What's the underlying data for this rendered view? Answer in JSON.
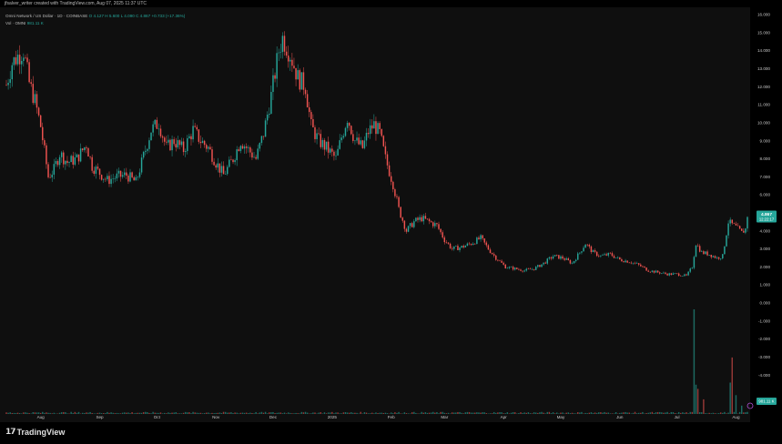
{
  "header": {
    "caption": "jfsalver_writer created with TradingView.com, Aug 07, 2025 11:37 UTC"
  },
  "legend": {
    "symbol": "Omni Network / US Dollar · 1D · COINBASE",
    "ohlc": "O 4.127 H 5.600 L 4.090 C 4.867 +0.733 (+17.36%)",
    "volume_label": "Vol · OMNI",
    "volume_value": "981.11 K"
  },
  "price_badge": {
    "price": "4.867",
    "countdown": "12:22:17"
  },
  "volume_badge": "981.11 K",
  "brand": {
    "name": "TradingView"
  },
  "colors": {
    "up": "#26a69a",
    "down": "#ef5350",
    "background": "#0f0f0f"
  },
  "chart_data": {
    "type": "candlestick",
    "title": "Omni Network / US Dollar",
    "ylim": [
      -5,
      16
    ],
    "y_ticks": [
      "16.000",
      "15.000",
      "14.000",
      "13.000",
      "12.000",
      "11.000",
      "10.000",
      "9.000",
      "8.000",
      "7.000",
      "6.000",
      "5.000",
      "4.000",
      "3.000",
      "2.000",
      "1.000",
      "0.000",
      "-1.000",
      "-2.000",
      "-3.000",
      "-4.000"
    ],
    "x_ticks": [
      {
        "label": "Aug",
        "date": "2024-08-01"
      },
      {
        "label": "Sep",
        "date": "2024-09-01"
      },
      {
        "label": "Oct",
        "date": "2024-10-01"
      },
      {
        "label": "Nov",
        "date": "2024-11-01"
      },
      {
        "label": "Dec",
        "date": "2024-12-01"
      },
      {
        "label": "2025",
        "date": "2025-01-01"
      },
      {
        "label": "Feb",
        "date": "2025-02-01"
      },
      {
        "label": "Mar",
        "date": "2025-03-01"
      },
      {
        "label": "Apr",
        "date": "2025-04-01"
      },
      {
        "label": "May",
        "date": "2025-05-01"
      },
      {
        "label": "Jun",
        "date": "2025-06-01"
      },
      {
        "label": "Jul",
        "date": "2025-07-01"
      },
      {
        "label": "Aug",
        "date": "2025-08-01"
      }
    ],
    "x_range": [
      "2024-07-14",
      "2025-08-07"
    ],
    "close_keypoints": [
      [
        "2024-07-14",
        12.1
      ],
      [
        "2024-07-17",
        13.3
      ],
      [
        "2024-07-20",
        13.7
      ],
      [
        "2024-07-23",
        14.0
      ],
      [
        "2024-07-26",
        12.2
      ],
      [
        "2024-07-29",
        11.2
      ],
      [
        "2024-08-01",
        9.8
      ],
      [
        "2024-08-05",
        7.0
      ],
      [
        "2024-08-08",
        7.4
      ],
      [
        "2024-08-11",
        8.3
      ],
      [
        "2024-08-15",
        7.8
      ],
      [
        "2024-08-20",
        8.0
      ],
      [
        "2024-08-25",
        8.8
      ],
      [
        "2024-08-28",
        7.6
      ],
      [
        "2024-09-01",
        7.2
      ],
      [
        "2024-09-05",
        6.8
      ],
      [
        "2024-09-10",
        7.0
      ],
      [
        "2024-09-15",
        7.1
      ],
      [
        "2024-09-20",
        6.7
      ],
      [
        "2024-09-25",
        8.5
      ],
      [
        "2024-09-28",
        9.6
      ],
      [
        "2024-10-02",
        10.0
      ],
      [
        "2024-10-06",
        8.6
      ],
      [
        "2024-10-10",
        9.0
      ],
      [
        "2024-10-15",
        8.5
      ],
      [
        "2024-10-20",
        9.6
      ],
      [
        "2024-10-24",
        9.0
      ],
      [
        "2024-10-28",
        8.6
      ],
      [
        "2024-11-01",
        7.8
      ],
      [
        "2024-11-05",
        7.1
      ],
      [
        "2024-11-10",
        8.0
      ],
      [
        "2024-11-14",
        9.0
      ],
      [
        "2024-11-18",
        8.5
      ],
      [
        "2024-11-22",
        8.0
      ],
      [
        "2024-11-26",
        9.4
      ],
      [
        "2024-11-30",
        11.5
      ],
      [
        "2024-12-04",
        14.0
      ],
      [
        "2024-12-06",
        14.7
      ],
      [
        "2024-12-10",
        13.8
      ],
      [
        "2024-12-14",
        12.5
      ],
      [
        "2024-12-18",
        12.0
      ],
      [
        "2024-12-21",
        9.8
      ],
      [
        "2024-12-25",
        9.0
      ],
      [
        "2024-12-29",
        8.6
      ],
      [
        "2025-01-03",
        8.0
      ],
      [
        "2025-01-06",
        9.2
      ],
      [
        "2025-01-09",
        10.3
      ],
      [
        "2025-01-13",
        9.0
      ],
      [
        "2025-01-17",
        8.6
      ],
      [
        "2025-01-20",
        9.5
      ],
      [
        "2025-01-23",
        9.9
      ],
      [
        "2025-01-26",
        9.4
      ],
      [
        "2025-01-29",
        8.0
      ],
      [
        "2025-02-02",
        6.6
      ],
      [
        "2025-02-05",
        5.2
      ],
      [
        "2025-02-09",
        4.0
      ],
      [
        "2025-02-13",
        4.5
      ],
      [
        "2025-02-17",
        4.7
      ],
      [
        "2025-02-21",
        4.5
      ],
      [
        "2025-02-25",
        4.3
      ],
      [
        "2025-03-01",
        3.5
      ],
      [
        "2025-03-05",
        3.0
      ],
      [
        "2025-03-10",
        3.1
      ],
      [
        "2025-03-15",
        3.3
      ],
      [
        "2025-03-20",
        3.6
      ],
      [
        "2025-03-24",
        3.0
      ],
      [
        "2025-03-28",
        2.5
      ],
      [
        "2025-04-02",
        2.0
      ],
      [
        "2025-04-07",
        1.9
      ],
      [
        "2025-04-12",
        1.8
      ],
      [
        "2025-04-17",
        1.9
      ],
      [
        "2025-04-22",
        2.2
      ],
      [
        "2025-04-27",
        2.6
      ],
      [
        "2025-05-02",
        2.5
      ],
      [
        "2025-05-07",
        2.2
      ],
      [
        "2025-05-11",
        2.8
      ],
      [
        "2025-05-14",
        3.3
      ],
      [
        "2025-05-18",
        2.8
      ],
      [
        "2025-05-22",
        2.6
      ],
      [
        "2025-05-27",
        2.7
      ],
      [
        "2025-06-01",
        2.4
      ],
      [
        "2025-06-06",
        2.3
      ],
      [
        "2025-06-11",
        2.1
      ],
      [
        "2025-06-16",
        1.8
      ],
      [
        "2025-06-21",
        1.7
      ],
      [
        "2025-06-26",
        1.6
      ],
      [
        "2025-07-01",
        1.6
      ],
      [
        "2025-07-06",
        1.5
      ],
      [
        "2025-07-09",
        2.0
      ],
      [
        "2025-07-11",
        3.3
      ],
      [
        "2025-07-14",
        2.8
      ],
      [
        "2025-07-18",
        2.7
      ],
      [
        "2025-07-22",
        2.5
      ],
      [
        "2025-07-25",
        2.6
      ],
      [
        "2025-07-28",
        4.5
      ],
      [
        "2025-08-01",
        4.2
      ],
      [
        "2025-08-04",
        3.9
      ],
      [
        "2025-08-06",
        4.1
      ],
      [
        "2025-08-07",
        4.867
      ]
    ],
    "volume_scale_max": 5.0,
    "volume_spikes": [
      [
        "2025-07-10",
        5.0
      ],
      [
        "2025-07-11",
        1.4
      ],
      [
        "2025-07-12",
        1.2
      ],
      [
        "2025-07-15",
        0.7
      ],
      [
        "2025-07-29",
        1.5
      ],
      [
        "2025-07-30",
        2.7
      ],
      [
        "2025-08-01",
        0.9
      ],
      [
        "2025-08-04",
        0.4
      ]
    ]
  }
}
